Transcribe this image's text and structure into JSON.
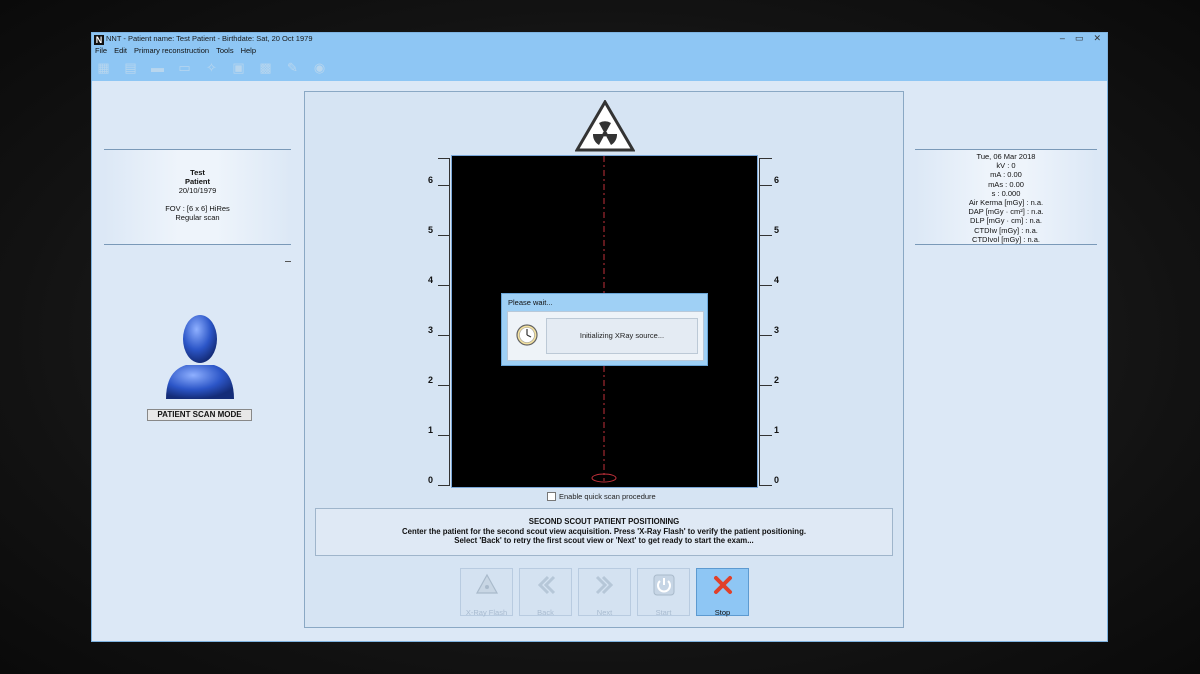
{
  "window": {
    "logo": "N",
    "title": "NNT - Patient name: Test Patient - Birthdate: Sat, 20 Oct 1979",
    "controls": [
      "–",
      "▭",
      "✕"
    ]
  },
  "menu": [
    "File",
    "Edit",
    "Primary reconstruction",
    "Tools",
    "Help"
  ],
  "toolbar_icons": [
    "save-icon",
    "save-all-icon",
    "folder-icon",
    "folder-open-icon",
    "wand-icon",
    "scan-icon",
    "image-icon",
    "pen-icon",
    "help-icon"
  ],
  "patient": {
    "first": "Test",
    "last": "Patient",
    "dob": "20/10/1979",
    "fov": "FOV : [6 x 6] HiRes",
    "scan": "Regular scan"
  },
  "exposure": {
    "date": "Tue, 06 Mar 2018",
    "lines": [
      "kV : 0",
      "mA : 0.00",
      "mAs : 0.00",
      "s : 0.000",
      "Air Kerma [mGy] : n.a.",
      "DAP [mGy · cm²] : n.a.",
      "DLP [mGy · cm] : n.a.",
      "CTDIw [mGy] : n.a.",
      "CTDIvol [mGy] : n.a."
    ]
  },
  "mode_label": "PATIENT SCAN MODE",
  "ruler_ticks": [
    "6",
    "5",
    "4",
    "3",
    "2",
    "1",
    "0"
  ],
  "dialog": {
    "title": "Please wait...",
    "message": "Initializing XRay source..."
  },
  "quick_scan_label": "Enable quick scan procedure",
  "instructions": {
    "title": "SECOND SCOUT PATIENT POSITIONING",
    "line1": "Center the patient for the second scout view acquisition. Press 'X-Ray Flash' to verify the patient positioning.",
    "line2": "Select 'Back' to retry the first scout view or 'Next' to get ready to start the exam..."
  },
  "buttons": {
    "xray": "X-Ray Flash",
    "back": "Back",
    "next": "Next",
    "start": "Start",
    "stop": "Stop"
  },
  "colors": {
    "accent": "#8ec6f4",
    "stop_x": "#e0402a"
  }
}
